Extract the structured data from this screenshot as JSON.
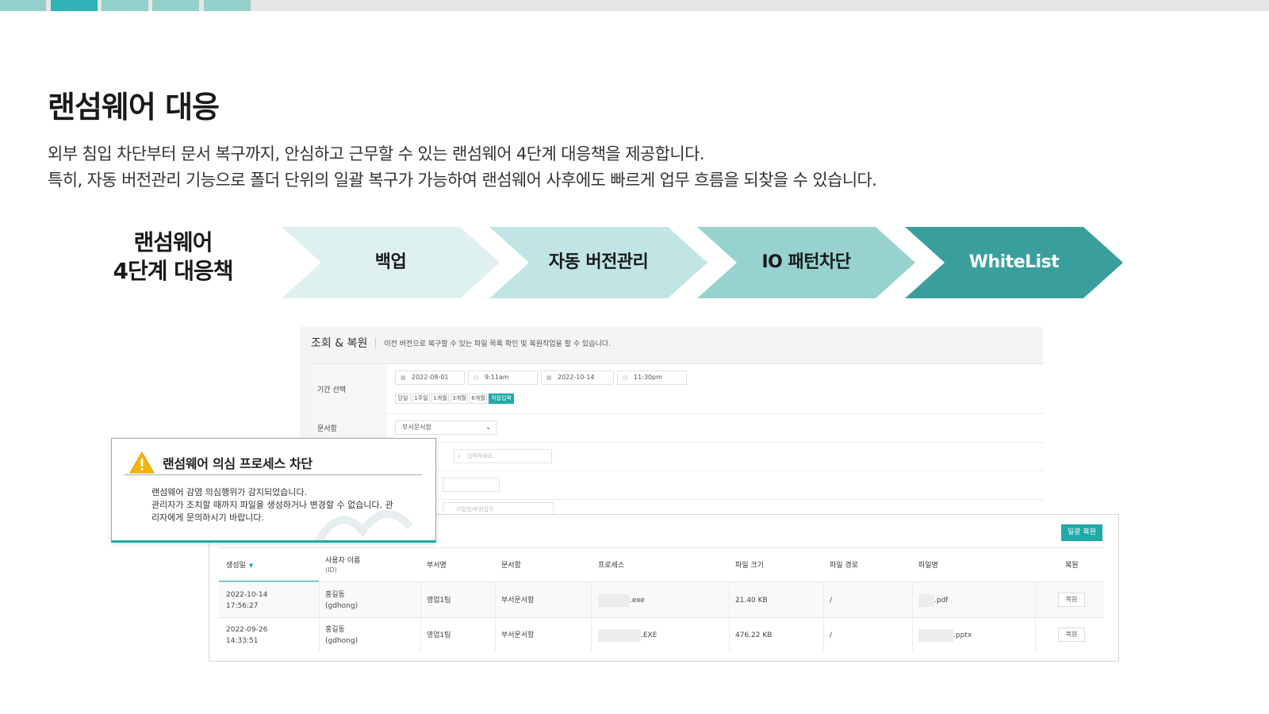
{
  "header": {
    "title": "랜섬웨어 대응",
    "description_lines": [
      "외부 침입 차단부터 문서 복구까지, 안심하고 근무할 수 있는 랜섬웨어 4단계 대응책을 제공합니다.",
      "특히, 자동 버전관리 기능으로 폴더 단위의 일괄 복구가 가능하여 랜섬웨어 사후에도 빠르게 업무 흐름을 되찾을 수 있습니다."
    ]
  },
  "steps": {
    "label_lines": [
      "랜섬웨어",
      "4단계 대응책"
    ],
    "items": [
      {
        "label": "백업",
        "color": "#dff0f1"
      },
      {
        "label": "자동 버전관리",
        "color": "#c0e5e4"
      },
      {
        "label": "IO 패턴차단",
        "color": "#97d2cf"
      },
      {
        "label": "WhiteList",
        "color": "#3a9f9c"
      }
    ]
  },
  "restore_form": {
    "title": "조회 & 복원",
    "description": "이전 버전으로 복구할 수 있는 파일 목록 확인 및 복원작업을 할 수 있습니다.",
    "period_label": "기간 선택",
    "start_date": "2022-08-01",
    "start_time": "9:11am",
    "end_date": "2022-10-14",
    "end_time": "11:30pm",
    "quick_ranges": [
      "당일",
      "1주일",
      "1개월",
      "3개월",
      "6개월",
      "직접입력"
    ],
    "active_range": "직접입력",
    "doc_box_label": "문서함",
    "doc_box_value": "부서문서함",
    "search_placeholder": "입력하세요",
    "dept_placeholder": "기업임/부원업무"
  },
  "alert": {
    "title": "랜섬웨어 의심 프로세스 차단",
    "body_lines": [
      "랜섬웨어 감염 의심행위가 감지되었습니다.",
      "관리자가 조치할 때까지 파일을 생성하거나 변경할 수 없습니다. 관",
      "리자에게 문의하시기 바랍니다."
    ]
  },
  "table": {
    "bulk_restore_label": "일괄 복원",
    "columns": [
      {
        "key": "created",
        "label": "생성일",
        "sub": ""
      },
      {
        "key": "user",
        "label": "사용자 이름",
        "sub": "(ID)"
      },
      {
        "key": "dept",
        "label": "부서명",
        "sub": ""
      },
      {
        "key": "docbox",
        "label": "문서함",
        "sub": ""
      },
      {
        "key": "process",
        "label": "프로세스",
        "sub": ""
      },
      {
        "key": "size",
        "label": "파일 크기",
        "sub": ""
      },
      {
        "key": "path",
        "label": "파일 경로",
        "sub": ""
      },
      {
        "key": "name",
        "label": "파일명",
        "sub": ""
      },
      {
        "key": "restore",
        "label": "복원",
        "sub": ""
      }
    ],
    "rows": [
      {
        "date": "2022-10-14",
        "time": "17:56:27",
        "user": "홍길동",
        "user_id": "(gdhong)",
        "dept": "영업1팀",
        "docbox": "부서문서함",
        "process": ".exe",
        "size": "21.40 KB",
        "path": "/",
        "name": ".pdf",
        "restore": "복원"
      },
      {
        "date": "2022-09-26",
        "time": "14:33:51",
        "user": "홍길동",
        "user_id": "(gdhong)",
        "dept": "영업1팀",
        "docbox": "부서문서함",
        "process": ".EXE",
        "size": "476.22 KB",
        "path": "/",
        "name": ".pptx",
        "restore": "복원"
      }
    ]
  },
  "icons": {
    "calendar": "calendar-icon",
    "clock": "clock-icon",
    "search": "search-icon",
    "warning": "warning-triangle-icon",
    "sort": "caret-down-icon",
    "dropdown": "chevron-down-icon"
  },
  "colors": {
    "accent": "#1fa9a9",
    "warning": "#f5b400"
  }
}
